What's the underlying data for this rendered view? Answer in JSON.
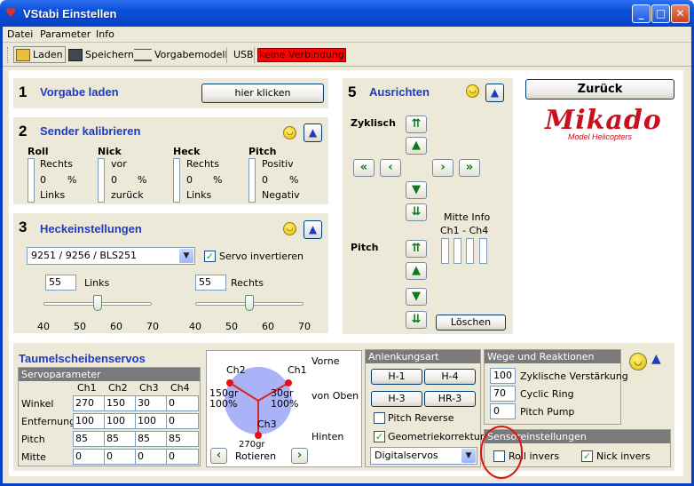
{
  "window": {
    "title": "VStabi Einstellen"
  },
  "menu": [
    "Datei",
    "Parameter",
    "Info"
  ],
  "toolbar": {
    "laden": "Laden",
    "speichern": "Speichern",
    "vorgabemodell": "Vorgabemodell",
    "usb": "USB",
    "status": "keine Verbindung",
    "status_color": "#ff0000"
  },
  "s1": {
    "num": "1",
    "title": "Vorgabe laden",
    "button": "hier klicken"
  },
  "s2": {
    "num": "2",
    "title": "Sender kalibrieren",
    "channels": [
      {
        "name": "Roll",
        "top": "Rechts",
        "mid": "0",
        "unit": "%",
        "bottom": "Links"
      },
      {
        "name": "Nick",
        "top": "vor",
        "mid": "0",
        "unit": "%",
        "bottom": "zurück"
      },
      {
        "name": "Heck",
        "top": "Rechts",
        "mid": "0",
        "unit": "%",
        "bottom": "Links"
      },
      {
        "name": "Pitch",
        "top": "Positiv",
        "mid": "0",
        "unit": "%",
        "bottom": "Negativ"
      }
    ]
  },
  "s3": {
    "num": "3",
    "title": "Heckeinstellungen",
    "servo_select": "9251 / 9256 / BLS251",
    "servo_invert": "Servo invertieren",
    "left": {
      "value": "55",
      "label": "Links",
      "ticks": [
        "40",
        "50",
        "60",
        "70"
      ],
      "level": 55
    },
    "right": {
      "value": "55",
      "label": "Rechts",
      "ticks": [
        "40",
        "50",
        "60",
        "70"
      ],
      "level": 55
    }
  },
  "s5": {
    "num": "5",
    "title": "Ausrichten",
    "zyklisch": "Zyklisch",
    "pitch": "Pitch",
    "mitte_info": "Mitte Info",
    "ch_range": "Ch1 - Ch4",
    "loeschen": "Löschen"
  },
  "zurueck": "Zurück",
  "logo": {
    "name": "Mikado",
    "sub": "Model Helicopters",
    "color": "#c8101e"
  },
  "taumel": {
    "title": "Taumelscheibenservos",
    "group": "Servoparameter",
    "cols": [
      "Ch1",
      "Ch2",
      "Ch3",
      "Ch4"
    ],
    "rows": [
      {
        "label": "Winkel",
        "values": [
          "270",
          "150",
          "30",
          "0"
        ]
      },
      {
        "label": "Entfernung",
        "values": [
          "100",
          "100",
          "100",
          "0"
        ]
      },
      {
        "label": "Pitch",
        "values": [
          "85",
          "85",
          "85",
          "85"
        ]
      },
      {
        "label": "Mitte",
        "values": [
          "0",
          "0",
          "0",
          "0"
        ]
      }
    ]
  },
  "diagram": {
    "vorne": "Vorne",
    "von_oben": "von Oben",
    "hinten": "Hinten",
    "ch2": "Ch2",
    "ch1": "Ch1",
    "ch3": "Ch3",
    "left_angle": "150gr",
    "left_pct": "100%",
    "right_angle": "30gr",
    "right_pct": "100%",
    "bottom_angle": "270gr",
    "rotieren": "Rotieren"
  },
  "anlenkung": {
    "title": "Anlenkungsart",
    "buttons": [
      "H-1",
      "H-4",
      "H-3",
      "HR-3"
    ],
    "pitch_reverse": "Pitch Reverse",
    "geometrie": "Geometriekorrektur",
    "servotyp": "Digitalservos"
  },
  "wege": {
    "title": "Wege und Reaktionen",
    "rows": [
      {
        "value": "100",
        "label": "Zyklische Verstärkung"
      },
      {
        "value": "70",
        "label": "Cyclic Ring"
      },
      {
        "value": "0",
        "label": "Pitch Pump"
      }
    ]
  },
  "sensor": {
    "title": "Sensoreinstellungen",
    "roll_invers": "Roll invers",
    "nick_invers": "Nick invers"
  }
}
